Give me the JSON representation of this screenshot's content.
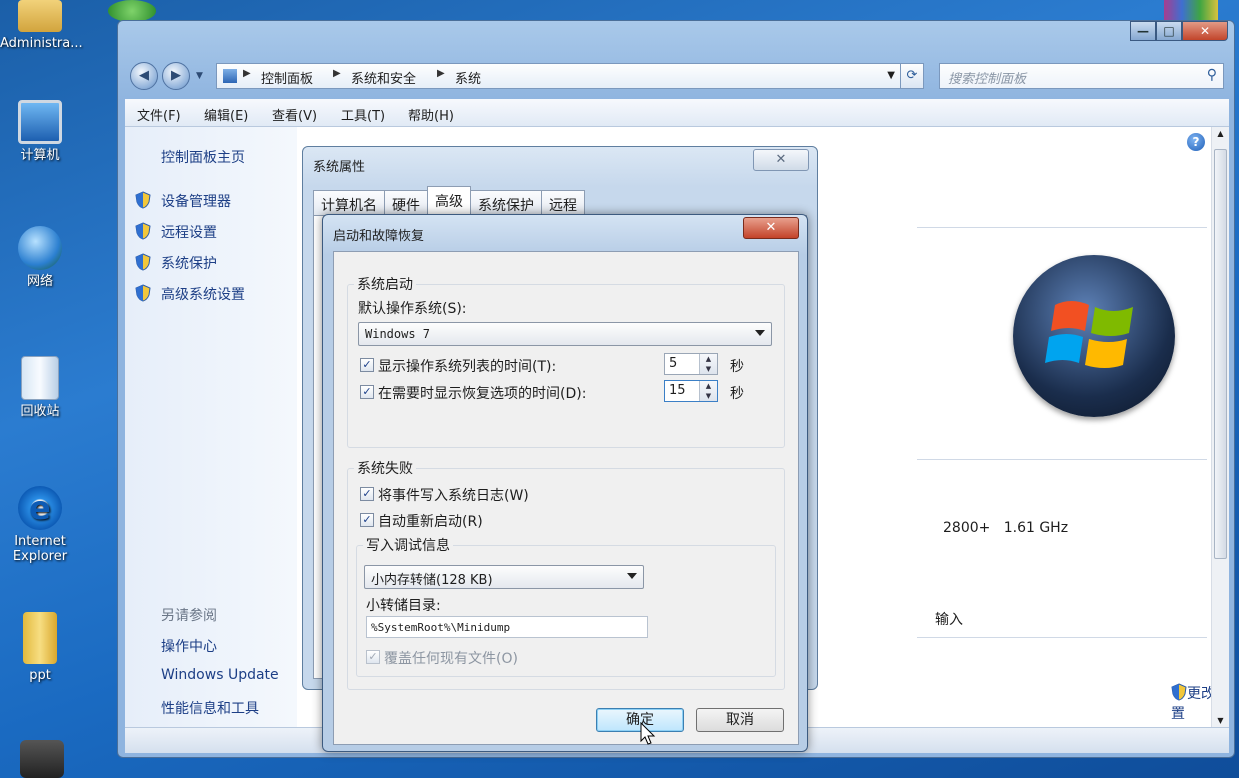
{
  "desktop": {
    "icons": [
      {
        "label": "Administra..."
      },
      {
        "label": "计算机"
      },
      {
        "label": "网络"
      },
      {
        "label": "回收站"
      },
      {
        "label": "Internet Explorer"
      },
      {
        "label": "ppt"
      }
    ]
  },
  "explorer": {
    "address": {
      "crumbs": [
        "控制面板",
        "系统和安全",
        "系统"
      ]
    },
    "search_placeholder": "搜索控制面板",
    "menu": [
      "文件(F)",
      "编辑(E)",
      "查看(V)",
      "工具(T)",
      "帮助(H)"
    ],
    "left_links": [
      "控制面板主页",
      "设备管理器",
      "远程设置",
      "系统保护",
      "高级系统设置"
    ],
    "see_also": {
      "title": "另请参阅",
      "links": [
        "操作中心",
        "Windows Update",
        "性能信息和工具"
      ]
    },
    "main": {
      "cpu_text": "2800+   1.61 GHz",
      "input_fragment": "输入",
      "change_settings": "更改设置"
    }
  },
  "sysprops": {
    "title": "系统属性",
    "tabs": [
      "计算机名",
      "硬件",
      "高级",
      "系统保护",
      "远程"
    ],
    "active_tab": "高级"
  },
  "startup": {
    "title": "启动和故障恢复",
    "system_startup": {
      "group_label": "系统启动",
      "default_os_label": "默认操作系统(S):",
      "default_os_value": "Windows 7",
      "show_os_list_label": "显示操作系统列表的时间(T):",
      "show_os_list_value": "5",
      "show_recovery_label": "在需要时显示恢复选项的时间(D):",
      "show_recovery_value": "15",
      "unit": "秒"
    },
    "system_failure": {
      "group_label": "系统失败",
      "write_event_label": "将事件写入系统日志(W)",
      "auto_restart_label": "自动重新启动(R)",
      "debug_group_label": "写入调试信息",
      "debug_value": "小内存转储(128 KB)",
      "dump_dir_label": "小转储目录:",
      "dump_dir_value": "%SystemRoot%\\Minidump",
      "overwrite_label": "覆盖任何现有文件(O)"
    },
    "ok_label": "确定",
    "cancel_label": "取消"
  }
}
